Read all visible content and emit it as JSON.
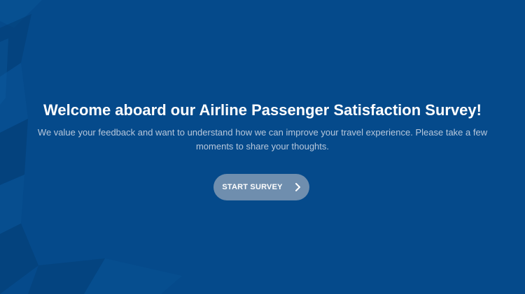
{
  "welcome": {
    "title": "Welcome aboard our Airline Passenger Satisfaction Survey!",
    "description": "We value your feedback and want to understand how we can improve your travel experience. Please take a few moments to share your thoughts.",
    "start_button_label": "START SURVEY",
    "start_button_icon": "chevron-right-icon"
  },
  "colors": {
    "background": "#054a8b",
    "button": "#6f8eae",
    "title_text": "#ffffff",
    "description_text": "#b8c8dc"
  }
}
